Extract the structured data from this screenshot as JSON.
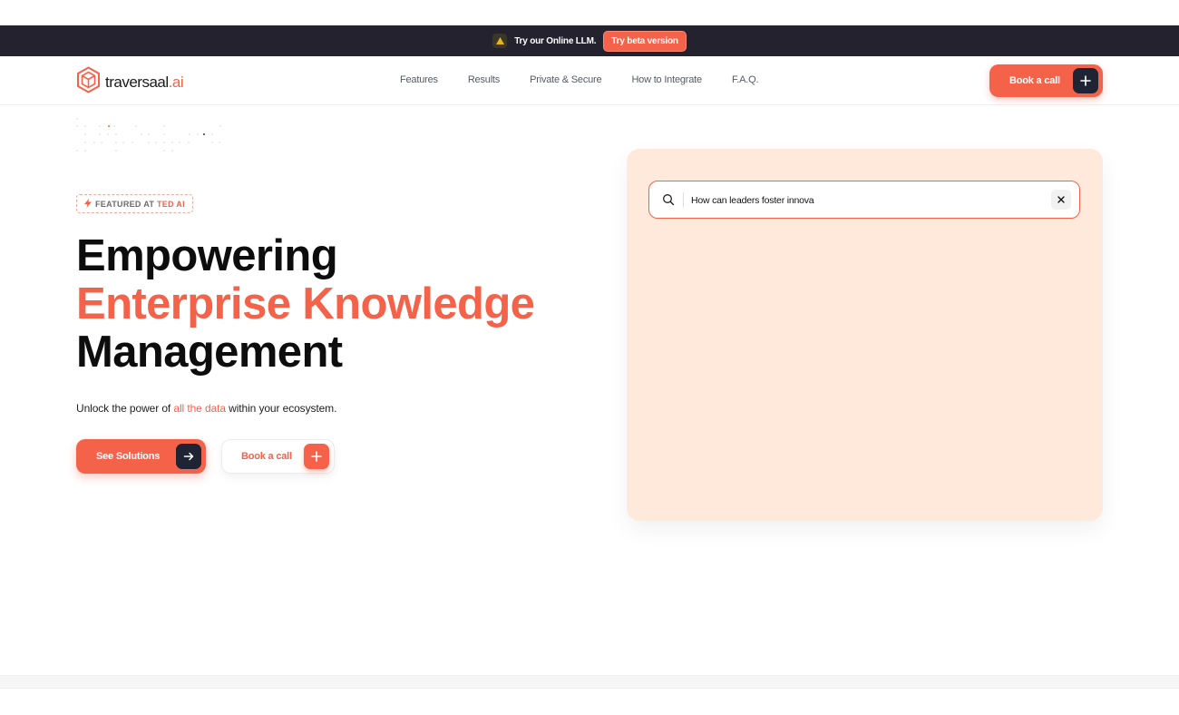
{
  "announcement": {
    "text": "Try our Online LLM.",
    "button_label": "Try beta version",
    "icon": "warning-icon"
  },
  "navbar": {
    "logo": {
      "text": "traversaal",
      "suffix": ".ai",
      "icon": "hexagon-logo-icon"
    },
    "links": [
      "Features",
      "Results",
      "Private & Secure",
      "How to Integrate",
      "F.A.Q."
    ],
    "cta_label": "Book a call",
    "cta_icon": "plus-icon"
  },
  "hero": {
    "badge": {
      "prefix": "FEATURED AT ",
      "highlight": "TED AI",
      "icon": "lightning-icon"
    },
    "headline": {
      "line1": "Empowering",
      "line2": "Enterprise Knowledge",
      "line3": "Management"
    },
    "subline": {
      "before": "Unlock the power of ",
      "highlight": "all the data",
      "after": " within your ecosystem."
    },
    "primary_button": {
      "label": "See Solutions",
      "icon": "arrow-right-icon"
    },
    "secondary_button": {
      "label": "Book a call",
      "icon": "plus-icon"
    }
  },
  "demo": {
    "search": {
      "value": "How can leaders foster innova",
      "icon": "search-icon",
      "clear_icon": "close-icon"
    }
  },
  "colors": {
    "accent": "#f4624a",
    "dark": "#1e2433",
    "announce_bg": "#25222f",
    "panel_bg": "#ffe9da"
  }
}
